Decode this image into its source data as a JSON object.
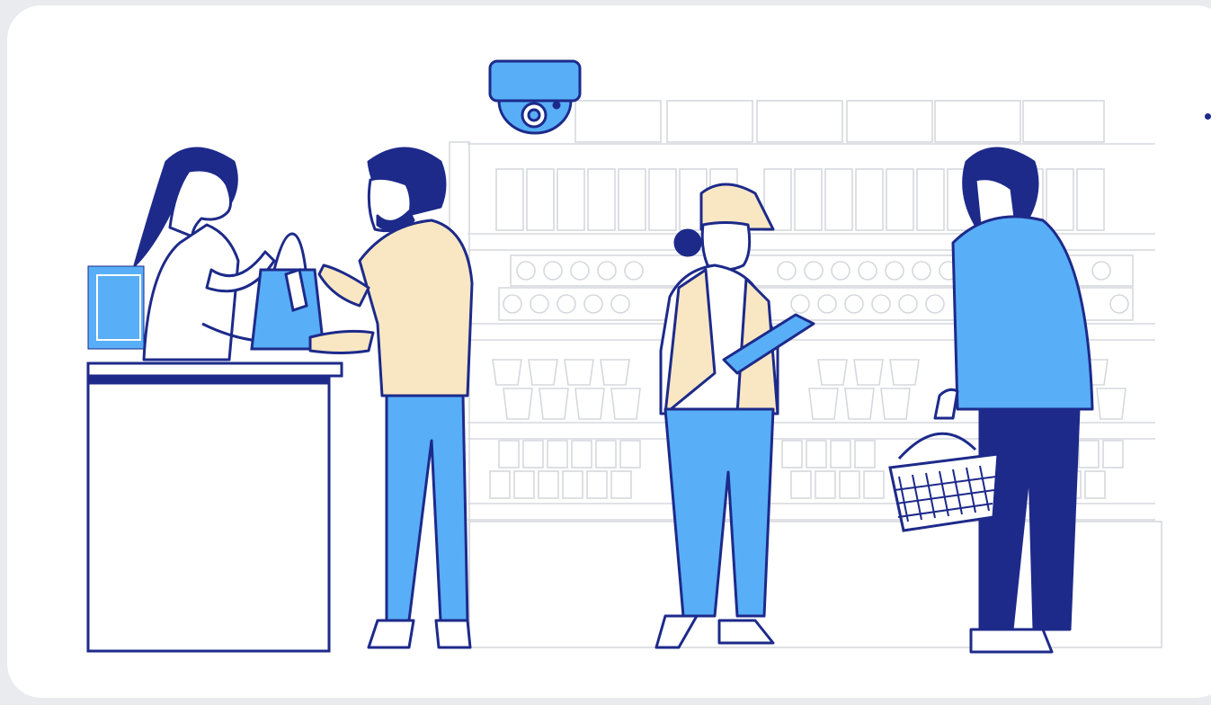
{
  "colors": {
    "background": "#e9ebef",
    "card": "#ffffff",
    "outline": "#1d2a8a",
    "accent_blue": "#58aef7",
    "accent_cream": "#f9e7c3",
    "shelf_line": "#d5d8de",
    "dark_navy": "#1d2a8a"
  },
  "scene": {
    "characters": [
      "cashier",
      "customer-with-bag",
      "store-staff-with-clipboard",
      "shopper-with-basket"
    ],
    "objects": [
      "security-camera",
      "checkout-counter",
      "cash-register-monitor",
      "store-shelves",
      "shopping-bag",
      "clipboard",
      "shopping-basket"
    ]
  }
}
